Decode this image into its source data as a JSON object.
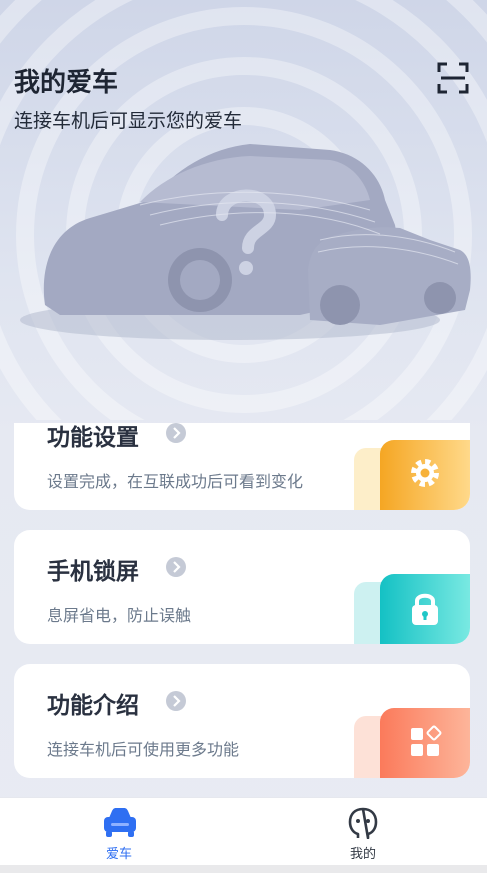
{
  "header": {
    "title": "我的爱车",
    "subtitle": "连接车机后可显示您的爱车",
    "scan_icon": "scan-icon"
  },
  "cards": [
    {
      "title": "功能设置",
      "desc": "设置完成，在互联成功后可看到变化",
      "icon": "gear-icon",
      "accent": "#f5a623"
    },
    {
      "title": "手机锁屏",
      "desc": "息屏省电，防止误触",
      "icon": "lock-icon",
      "accent": "#1fc7c7"
    },
    {
      "title": "功能介绍",
      "desc": "连接车机后可使用更多功能",
      "icon": "grid-icon",
      "accent": "#fb8566"
    }
  ],
  "tabbar": {
    "tabs": [
      {
        "label": "爱车",
        "icon": "car-icon",
        "active": true
      },
      {
        "label": "我的",
        "icon": "profile-icon",
        "active": false
      }
    ],
    "active_color": "#2f6ff2",
    "inactive_color": "#333a45"
  }
}
